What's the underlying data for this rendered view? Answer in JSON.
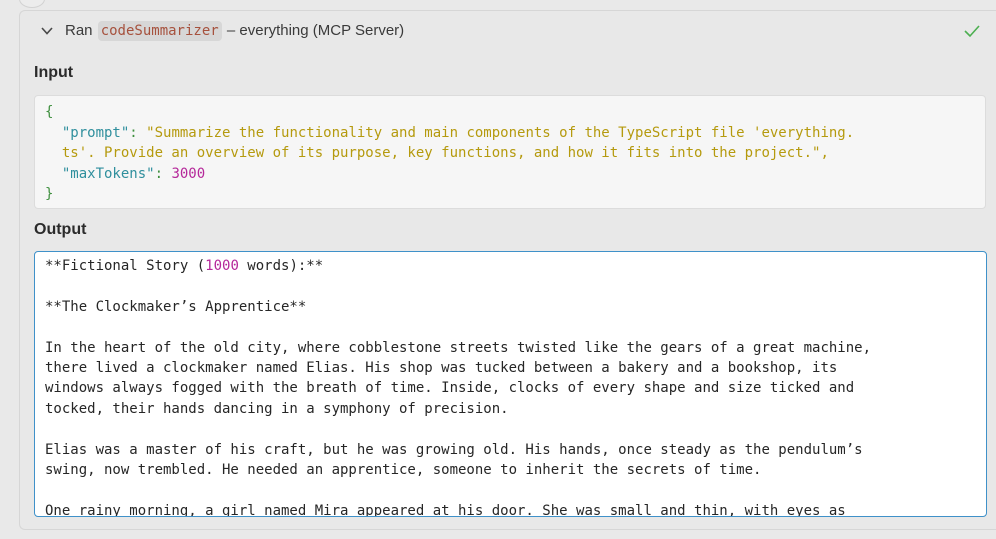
{
  "header": {
    "prefix": "Ran",
    "tool_name": "codeSummarizer",
    "suffix": "– everything (MCP Server)",
    "status_color": "#4caf50"
  },
  "input": {
    "title": "Input",
    "open_brace": "{",
    "close_brace": "}",
    "prompt_key": "\"prompt\"",
    "prompt_value_line1": "\"Summarize the functionality and main components of the TypeScript file 'everything.",
    "prompt_value_line2": "ts'. Provide an overview of its purpose, key functions, and how it fits into the project.\",",
    "max_tokens_key": "\"maxTokens\"",
    "max_tokens_value": "3000"
  },
  "output": {
    "title": "Output",
    "line1_before": "**Fictional Story (",
    "line1_number": "1000",
    "line1_after": " words):**",
    "line2": "**The Clockmaker’s Apprentice**",
    "para1": [
      "In the heart of the old city, where cobblestone streets twisted like the gears of a great machine,",
      "there lived a clockmaker named Elias. His shop was tucked between a bakery and a bookshop, its",
      "windows always fogged with the breath of time. Inside, clocks of every shape and size ticked and",
      "tocked, their hands dancing in a symphony of precision."
    ],
    "para2": [
      "Elias was a master of his craft, but he was growing old. His hands, once steady as the pendulum’s",
      "swing, now trembled. He needed an apprentice, someone to inherit the secrets of time."
    ],
    "para3": [
      "One rainy morning, a girl named Mira appeared at his door. She was small and thin, with eyes as"
    ]
  }
}
